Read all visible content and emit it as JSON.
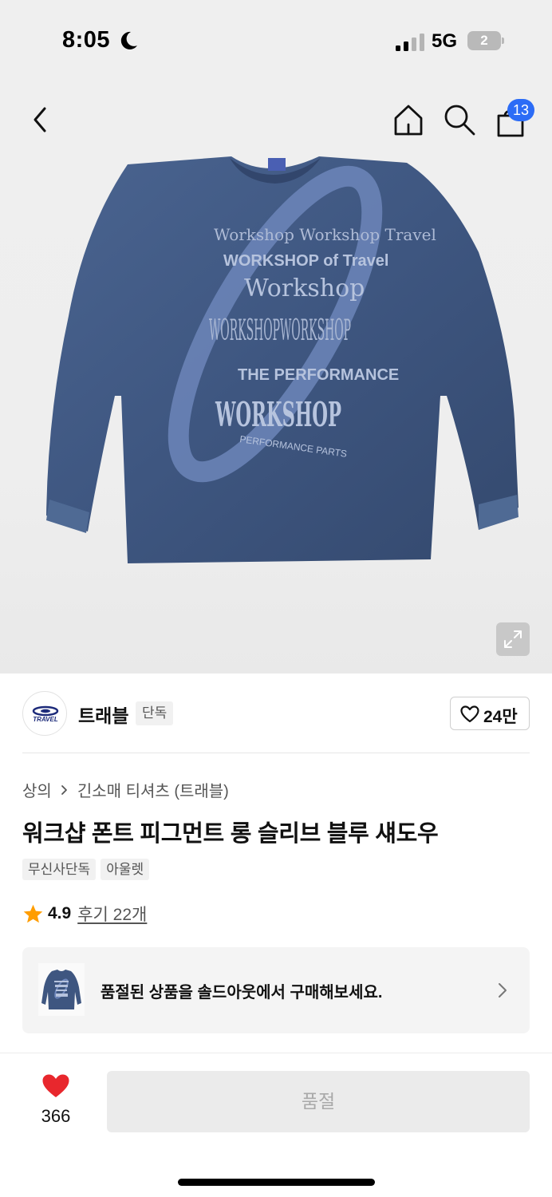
{
  "status_bar": {
    "time": "8:05",
    "network": "5G",
    "battery": "2"
  },
  "nav": {
    "cart_count": "13"
  },
  "brand": {
    "name": "트래블",
    "badge": "단독",
    "logo_text": "TRAVEL",
    "likes": "24만"
  },
  "breadcrumb": {
    "category": "상의",
    "subcategory": "긴소매 티셔츠 (트래블)"
  },
  "product": {
    "title": "워크샵 폰트 피그먼트 롱 슬리브 블루 섀도우",
    "tags": [
      "무신사단독",
      "아울렛"
    ],
    "rating": "4.9",
    "reviews": "후기 22개",
    "print_lines": [
      "Workshop Workshop Travel",
      "WORKSHOP of Travel",
      "Workshop",
      "WORKSHOPWORKSHOP",
      "THE PERFORMANCE",
      "WORKSHOP",
      "PERFORMANCE PARTS"
    ]
  },
  "soldout": {
    "text": "품절된 상품을 솔드아웃에서 구매해보세요."
  },
  "bottom": {
    "wish_count": "366",
    "buy_label": "품절"
  },
  "colors": {
    "accent": "#2c6cf6",
    "heart": "#e8272d",
    "star": "#ff9d00",
    "shirt": "#3f5880"
  }
}
